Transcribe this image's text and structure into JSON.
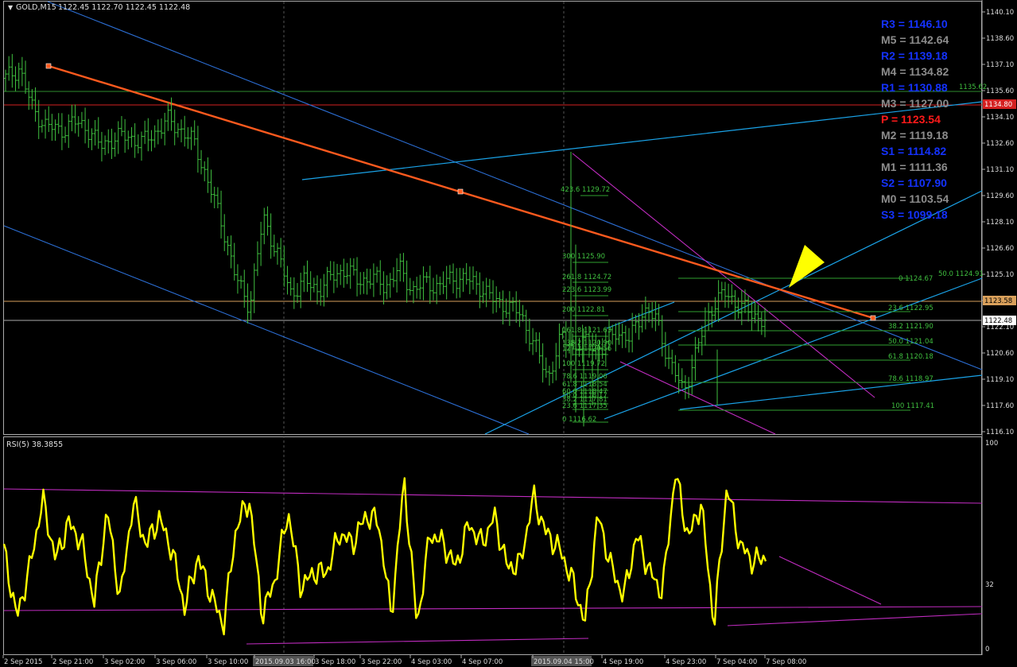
{
  "header": {
    "symbol": "GOLD,M15",
    "ohlc": "1122.45 1122.70 1122.45 1122.48"
  },
  "rsi": {
    "label": "RSI(5) 38.3855",
    "levels": [
      "100",
      "32",
      "0"
    ]
  },
  "price_tags": {
    "red_line": "1134.80",
    "orange_line": "1123.58",
    "current": "1122.48"
  },
  "pivots": [
    {
      "name": "R3",
      "value": "1146.10",
      "color": "#1432ff"
    },
    {
      "name": "M5",
      "value": "1142.64",
      "color": "#8c8c8c"
    },
    {
      "name": "R2",
      "value": "1139.18",
      "color": "#1432ff"
    },
    {
      "name": "M4",
      "value": "1134.82",
      "color": "#8c8c8c"
    },
    {
      "name": "R1",
      "value": "1130.88",
      "color": "#1432ff"
    },
    {
      "name": "M3",
      "value": "1127.00",
      "color": "#8c8c8c"
    },
    {
      "name": "P",
      "value": "1123.54",
      "color": "#ff1a1a"
    },
    {
      "name": "M2",
      "value": "1119.18",
      "color": "#8c8c8c"
    },
    {
      "name": "S1",
      "value": "1114.82",
      "color": "#1432ff"
    },
    {
      "name": "M1",
      "value": "1111.36",
      "color": "#8c8c8c"
    },
    {
      "name": "S2",
      "value": "1107.90",
      "color": "#1432ff"
    },
    {
      "name": "M0",
      "value": "1103.54",
      "color": "#8c8c8c"
    },
    {
      "name": "S3",
      "value": "1099.18",
      "color": "#1432ff"
    }
  ],
  "fib_left": [
    "423.6 1129.72",
    "300 1125.90",
    "261.8 1124.72",
    "223.6 1123.99",
    "200 1122.81",
    "161.8 1121.63",
    "138.2 1120.90",
    "127.2 1120.56",
    "100 1119.72",
    "78.6 1119.06",
    "61.8 1118.54",
    "60.0 1118.47",
    "50.0 1118.17",
    "38.2 1117.81",
    "23.6 1117.35",
    "0 1116.62"
  ],
  "fib_right": [
    "0 1124.67",
    "50.0 1124.91",
    "23.6 1122.95",
    "38.2 1121.90",
    "50.0 1121.04",
    "61.8 1120.18",
    "78.6 1118.97",
    "100 1117.41"
  ],
  "fib_top_right": "1135.62",
  "chart_data": {
    "type": "bar",
    "title": "GOLD,M15",
    "y_ticks": [
      "1140.10",
      "1138.60",
      "1137.10",
      "1135.60",
      "1134.10",
      "1132.60",
      "1131.10",
      "1129.60",
      "1128.10",
      "1126.60",
      "1125.10",
      "1123.60",
      "1122.10",
      "1120.60",
      "1119.10",
      "1117.60",
      "1116.10"
    ],
    "ylim": [
      1115.9,
      1140.4
    ],
    "x_ticks": [
      "2 Sep 2015",
      "2 Sep 21:00",
      "3 Sep 02:00",
      "3 Sep 06:00",
      "3 Sep 10:00",
      "2015.09.03 16:00",
      "3 Sep 18:00",
      "3 Sep 22:00",
      "4 Sep 03:00",
      "4 Sep 07:00",
      "2015.09.04 15:00",
      "4 Sep 19:00",
      "4 Sep 23:00",
      "7 Sep 04:00",
      "7 Sep 08:00"
    ],
    "close_series": [
      1136.3,
      1136.9,
      1134.5,
      1133.6,
      1133.3,
      1133.8,
      1133.5,
      1132.4,
      1132.9,
      1133.0,
      1132.6,
      1133.2,
      1133.9,
      1133.3,
      1132.5,
      1130.2,
      1127.9,
      1124.8,
      1123.3,
      1128.3,
      1126.4,
      1124.0,
      1124.7,
      1124.2,
      1124.9,
      1125.4,
      1124.7,
      1124.9,
      1124.4,
      1125.4,
      1124.2,
      1124.6,
      1124.4,
      1124.9,
      1124.8,
      1124.4,
      1123.6,
      1123.3,
      1122.8,
      1121.0,
      1119.2,
      1121.5,
      1121.0,
      1121.2,
      1120.8,
      1121.9,
      1121.3,
      1123.1,
      1122.5,
      1120.0,
      1118.4,
      1120.8,
      1123.2,
      1124.0,
      1123.4,
      1122.8,
      1122.5
    ],
    "rsi_values": [
      47.7,
      14.6,
      39.2,
      72.6,
      43.0,
      61.1,
      51.5,
      22.3,
      66.9,
      23.3,
      71.5,
      49.8,
      63.4,
      48.0,
      19.5,
      44.5,
      26.5,
      10.8,
      59.4,
      72.3,
      15.7,
      33.6,
      66.6,
      29.4,
      36.8,
      36.9,
      55.9,
      50.8,
      64.2,
      62.1,
      15.4,
      81.5,
      11.0,
      55.6,
      51.3,
      39.1,
      60.7,
      50.8,
      64.2,
      38.8,
      41.4,
      73.9,
      55.8,
      48.5,
      33.7,
      12.2,
      65.2,
      40.0,
      24.9,
      55.0,
      37.2,
      26.8,
      85.6,
      53.3,
      70.7,
      11.2,
      78.9,
      50.3,
      42.0,
      44.4
    ],
    "rsi_ylim": [
      0,
      100
    ]
  }
}
